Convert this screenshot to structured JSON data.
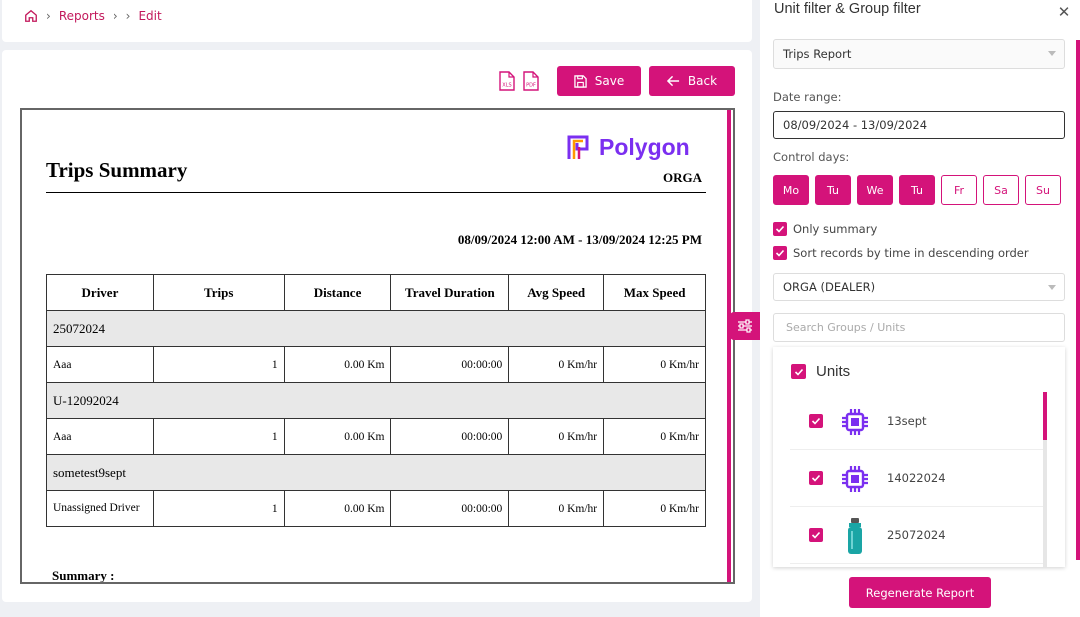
{
  "breadcrumb": {
    "items": [
      "Reports",
      "Edit"
    ]
  },
  "toolbar": {
    "xls_label": "XLS",
    "pdf_label": "PDF",
    "save_label": "Save",
    "back_label": "Back"
  },
  "report": {
    "title": "Trips Summary",
    "logo_text": "Polygon",
    "org": "ORGA",
    "date_range": "08/09/2024 12:00 AM - 13/09/2024 12:25 PM",
    "columns": [
      "Driver",
      "Trips",
      "Distance",
      "Travel Duration",
      "Avg Speed",
      "Max Speed"
    ],
    "groups": [
      {
        "name": "25072024",
        "rows": [
          [
            "Aaa",
            "1",
            "0.00 Km",
            "00:00:00",
            "0 Km/hr",
            "0 Km/hr"
          ]
        ]
      },
      {
        "name": "U-12092024",
        "rows": [
          [
            "Aaa",
            "1",
            "0.00 Km",
            "00:00:00",
            "0 Km/hr",
            "0 Km/hr"
          ]
        ]
      },
      {
        "name": "sometest9sept",
        "rows": [
          [
            "Unassigned Driver",
            "1",
            "0.00 Km",
            "00:00:00",
            "0 Km/hr",
            "0 Km/hr"
          ]
        ]
      }
    ],
    "summary_label": "Summary :"
  },
  "panel": {
    "title": "Unit filter & Group filter",
    "report_type": "Trips Report",
    "date_range_label": "Date range:",
    "date_range_value": "08/09/2024 - 13/09/2024",
    "control_days_label": "Control days:",
    "days": [
      {
        "label": "Mo",
        "active": true
      },
      {
        "label": "Tu",
        "active": true
      },
      {
        "label": "We",
        "active": true
      },
      {
        "label": "Tu",
        "active": true
      },
      {
        "label": "Fr",
        "active": false
      },
      {
        "label": "Sa",
        "active": false
      },
      {
        "label": "Su",
        "active": false
      }
    ],
    "only_summary_label": "Only summary",
    "sort_desc_label": "Sort records by time in descending order",
    "group_select": "ORGA (DEALER)",
    "search_placeholder": "Search Groups / Units",
    "units_label": "Units",
    "units": [
      {
        "name": "13sept",
        "icon": "chip-icon"
      },
      {
        "name": "14022024",
        "icon": "chip-icon"
      },
      {
        "name": "25072024",
        "icon": "bottle-icon"
      }
    ],
    "regenerate_label": "Regenerate Report"
  },
  "colors": {
    "accent": "#d4137a",
    "logo": "#7b2ff0",
    "chip": "#7b2ff0",
    "bottle": "#1aa5a5"
  }
}
